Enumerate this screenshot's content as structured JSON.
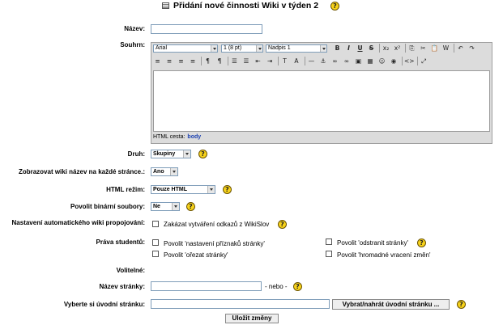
{
  "header": {
    "title": "Přidání nové činnosti Wiki v týden 2",
    "icon": "wiki-activity-icon"
  },
  "form": {
    "name": {
      "label": "Název:",
      "value": ""
    },
    "summary": {
      "label": "Souhrn:",
      "font_family": "Arial",
      "font_size": "1 (8 pt)",
      "heading": "Nadpis 1",
      "path_label": "HTML cesta:",
      "path_value": "body",
      "toolbar_row1": [
        "B",
        "I",
        "U",
        "S",
        "x₂",
        "x²",
        "⎘",
        "✂",
        "📋",
        "W",
        "↶",
        "↷"
      ],
      "toolbar_row2": [
        "≡",
        "≡",
        "≡",
        "≡",
        "¶",
        "¶",
        "☰",
        "☰",
        "⇤",
        "⇥",
        "T",
        "A",
        "—",
        "⚓",
        "∞",
        "∞",
        "▣",
        "▦",
        "☺",
        "◉",
        "<>",
        "⤢"
      ]
    },
    "type": {
      "label": "Druh:",
      "value": "Skupiny"
    },
    "show_name": {
      "label": "Zobrazovat wiki název na každé stránce.:",
      "value": "Ano"
    },
    "html_mode": {
      "label": "HTML režim:",
      "value": "Pouze HTML"
    },
    "binary": {
      "label": "Povolit binární soubory:",
      "value": "Ne"
    },
    "autolink": {
      "label": "Nastavení automatického wiki propojování:",
      "option": "Zakázat vytváření odkazů z WikiSlov"
    },
    "student_rights": {
      "label": "Práva studentů:",
      "options": [
        "Povolit 'nastavení příznaků stránky'",
        "Povolit 'odstranit stránky'",
        "Povolit 'ořezat stránky'",
        "Povolit 'hromadné vracení změn'"
      ]
    },
    "optional": {
      "label": "Volitelné:"
    },
    "page_name": {
      "label": "Název stránky:",
      "value": "",
      "suffix": "- nebo -"
    },
    "initial_page": {
      "label": "Vyberte si úvodní stránku:",
      "value": "",
      "button": "Vybrat/nahrát úvodní stránku ..."
    },
    "save_button": "Uložit změny"
  },
  "colors": {
    "help_icon": "#f7d21a",
    "editor_bg": "#dcdcdc",
    "link_blue": "#1a3fb0"
  }
}
